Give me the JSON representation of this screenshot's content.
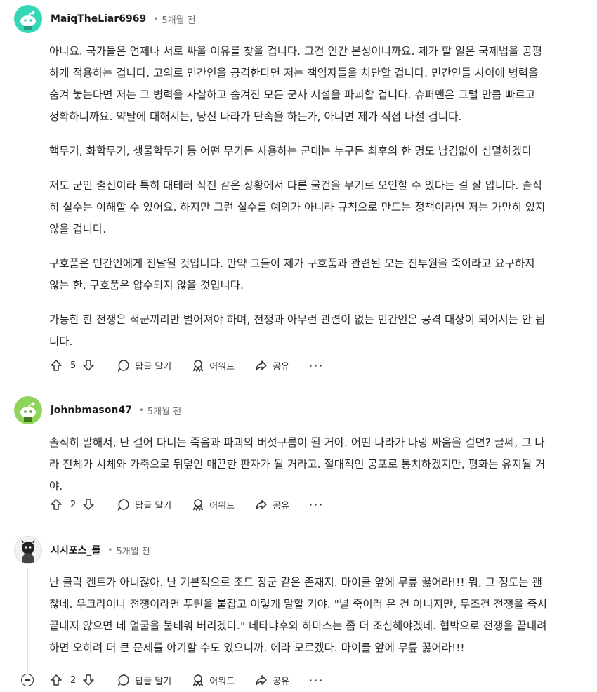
{
  "comments": [
    {
      "username": "MaiqTheLiar6969",
      "time": "5개월 전",
      "paragraphs": [
        "아니요. 국가들은 언제나 서로 싸울 이유를 찾을 겁니다. 그건 인간 본성이니까요. 제가 할 일은 국제법을 공평하게 적용하는 겁니다. 고의로 민간인을 공격한다면 저는 책임자들을 처단할 겁니다. 민간인들 사이에 병력을 숨겨 놓는다면 저는 그 병력을 사살하고 숨겨진 모든 군사 시설을 파괴할 겁니다. 슈퍼맨은 그럴 만큼 빠르고 정확하니까요. 약탈에 대해서는, 당신 나라가 단속을 하든가, 아니면 제가 직접 나설 겁니다.",
        "핵무기, 화학무기, 생물학무기 등 어떤 무기든 사용하는 군대는 누구든 최후의 한 명도 남김없이 섬멸하겠다",
        "저도 군인 출신이라 특히 대테러 작전 같은 상황에서 다른 물건을 무기로 오인할 수 있다는 걸 잘 압니다. 솔직히 실수는 이해할 수 있어요. 하지만 그런 실수를 예외가 아니라 규칙으로 만드는 정책이라면 저는 가만히 있지 않을 겁니다.",
        "구호품은 민간인에게 전달될 것입니다. 만약 그들이 제가 구호품과 관련된 모든 전투원을 죽이라고 요구하지 않는 한, 구호품은 압수되지 않을 것입니다.",
        "가능한 한 전쟁은 적군끼리만 벌어져야 하며, 전쟁과 아무런 관련이 없는 민간인은 공격 대상이 되어서는 안 됩니다."
      ],
      "score": "5"
    },
    {
      "username": "johnbmason47",
      "time": "5개월 전",
      "paragraphs": [
        "솔직히 말해서, 난 걸어 다니는 죽음과 파괴의 버섯구름이 될 거야. 어떤 나라가 나랑 싸움을 걸면? 글쎄, 그 나라 전체가 시체와 가축으로 뒤덮인 매끈한 판자가 될 거라고. 절대적인 공포로 통치하겠지만, 평화는 유지될 거야."
      ],
      "score": "2"
    },
    {
      "username": "시시포스_롤",
      "time": "5개월 전",
      "paragraphs": [
        "난 클락 켄트가 아니잖아. 난 기본적으로 조드 장군 같은 존재지. 마이클 앞에 무릎 꿇어라!!! 뭐, 그 정도는 괜찮네. 우크라이나 전쟁이라면 푸틴을 붙잡고 이렇게 말할 거야. \"널 죽이러 온 건 아니지만, 무조건 전쟁을 즉시 끝내지 않으면 네 얼굴을 불태워 버리겠다.\" 네타냐후와 하마스는 좀 더 조심해야겠네. 협박으로 전쟁을 끝내려 하면 오히려 더 큰 문제를 야기할 수도 있으니까. 에라 모르겠다. 마이클 앞에 무릎 꿇어라!!!"
      ],
      "score": "2"
    }
  ],
  "actions": {
    "reply": "답글 달기",
    "award": "어워드",
    "share": "공유",
    "more": "···"
  },
  "separator": "•"
}
